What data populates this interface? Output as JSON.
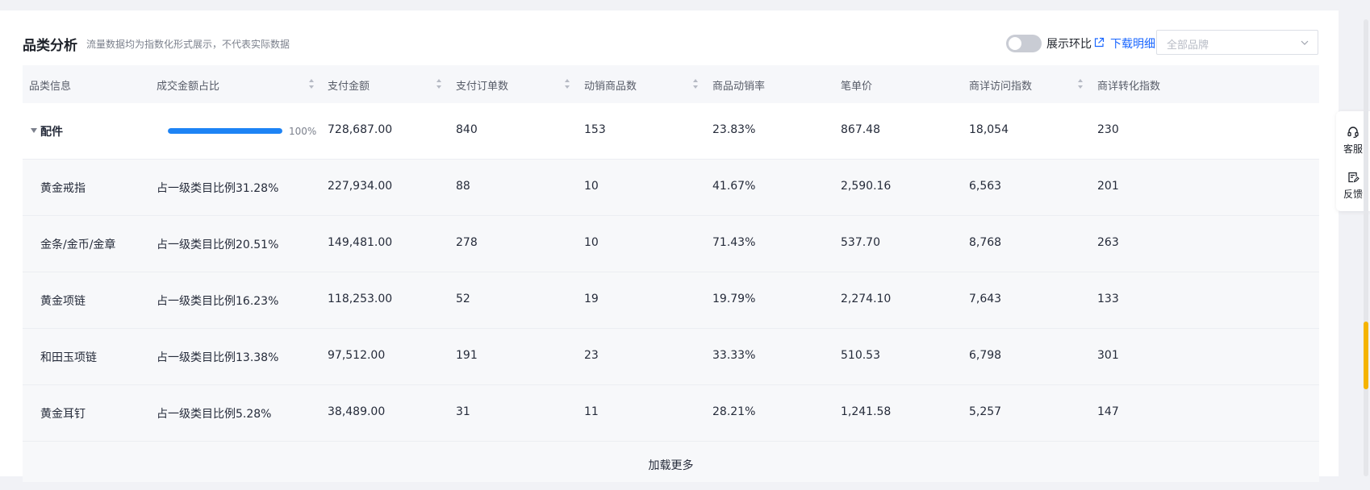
{
  "header": {
    "title": "品类分析",
    "subtitle": "流量数据均为指数化形式展示，不代表实际数据",
    "toggle_label": "展示环比",
    "toggle_on": false,
    "download_label": "下载明细",
    "brand_placeholder": "全部品牌"
  },
  "table": {
    "columns": [
      "品类信息",
      "成交金额占比",
      "支付金额",
      "支付订单数",
      "动销商品数",
      "商品动销率",
      "笔单价",
      "商详访问指数",
      "商详转化指数"
    ],
    "top_row": {
      "name": "配件",
      "share_percent": 100,
      "share_label": "100%",
      "pay_amount": "728,687.00",
      "orders": "840",
      "sold_items": "153",
      "sell_through": "23.83%",
      "avg_order": "867.48",
      "visit_index": "18,054",
      "conversion_index": "230"
    },
    "rows": [
      {
        "name": "黄金戒指",
        "share": "占一级类目比例31.28%",
        "pay_amount": "227,934.00",
        "orders": "88",
        "sold_items": "10",
        "sell_through": "41.67%",
        "avg_order": "2,590.16",
        "visit_index": "6,563",
        "conversion_index": "201"
      },
      {
        "name": "金条/金币/金章",
        "share": "占一级类目比例20.51%",
        "pay_amount": "149,481.00",
        "orders": "278",
        "sold_items": "10",
        "sell_through": "71.43%",
        "avg_order": "537.70",
        "visit_index": "8,768",
        "conversion_index": "263"
      },
      {
        "name": "黄金项链",
        "share": "占一级类目比例16.23%",
        "pay_amount": "118,253.00",
        "orders": "52",
        "sold_items": "19",
        "sell_through": "19.79%",
        "avg_order": "2,274.10",
        "visit_index": "7,643",
        "conversion_index": "133"
      },
      {
        "name": "和田玉项链",
        "share": "占一级类目比例13.38%",
        "pay_amount": "97,512.00",
        "orders": "191",
        "sold_items": "23",
        "sell_through": "33.33%",
        "avg_order": "510.53",
        "visit_index": "6,798",
        "conversion_index": "301"
      },
      {
        "name": "黄金耳钉",
        "share": "占一级类目比例5.28%",
        "pay_amount": "38,489.00",
        "orders": "31",
        "sold_items": "11",
        "sell_through": "28.21%",
        "avg_order": "1,241.58",
        "visit_index": "5,257",
        "conversion_index": "147"
      }
    ],
    "load_more": "加载更多"
  },
  "side_panel": {
    "service_label": "客服",
    "feedback_label": "反馈"
  },
  "colors": {
    "accent": "#1966ff",
    "bar": "#1d83f5",
    "scroll_thumb": "#f5b400"
  },
  "icons": {
    "service": "headset-icon",
    "feedback": "feedback-form-icon",
    "external": "external-link-icon",
    "sort": "sort-arrows-icon",
    "expand": "caret-down-icon",
    "dropdown": "chevron-down-icon"
  }
}
